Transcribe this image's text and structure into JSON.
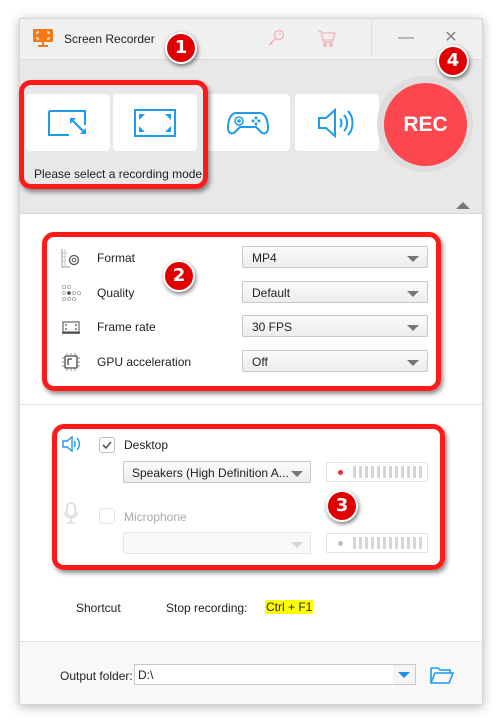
{
  "titlebar": {
    "title": "Screen Recorder",
    "app_icon": "monitor-capture-icon",
    "register_icon": "key-icon",
    "buy_icon": "cart-icon",
    "minimize_label": "—",
    "close_label": "✕"
  },
  "modes": {
    "items": [
      {
        "name": "custom-region",
        "icon": "region-resize-icon"
      },
      {
        "name": "full-screen",
        "icon": "fullscreen-icon"
      },
      {
        "name": "game",
        "icon": "gamepad-icon"
      },
      {
        "name": "audio-only",
        "icon": "speaker-icon"
      }
    ],
    "rec_label": "REC",
    "hint": "Please select a recording mode."
  },
  "settings": {
    "rows": [
      {
        "label": "Format",
        "value": "MP4",
        "icon": "format-gear-icon"
      },
      {
        "label": "Quality",
        "value": "Default",
        "icon": "quality-dots-icon"
      },
      {
        "label": "Frame rate",
        "value": "30 FPS",
        "icon": "frame-rate-icon"
      },
      {
        "label": "GPU acceleration",
        "value": "Off",
        "icon": "gpu-chip-icon"
      }
    ]
  },
  "audio": {
    "desktop": {
      "label": "Desktop",
      "checked": true,
      "device": "Speakers (High Definition A...",
      "meter_color": "#e8323a"
    },
    "microphone": {
      "label": "Microphone",
      "checked": false,
      "device": "",
      "meter_color": "#bdbdbd"
    }
  },
  "shortcut": {
    "label": "Shortcut",
    "action": "Stop recording:",
    "hotkey": "Ctrl + F1"
  },
  "output": {
    "label": "Output folder:",
    "value": "D:\\"
  },
  "annotations": [
    "1",
    "2",
    "3",
    "4"
  ],
  "colors": {
    "accent_blue": "#1e9be9",
    "rec_red": "#fb474d",
    "callout_red": "#ff1a1a",
    "brand_orange": "#f27a1a"
  }
}
